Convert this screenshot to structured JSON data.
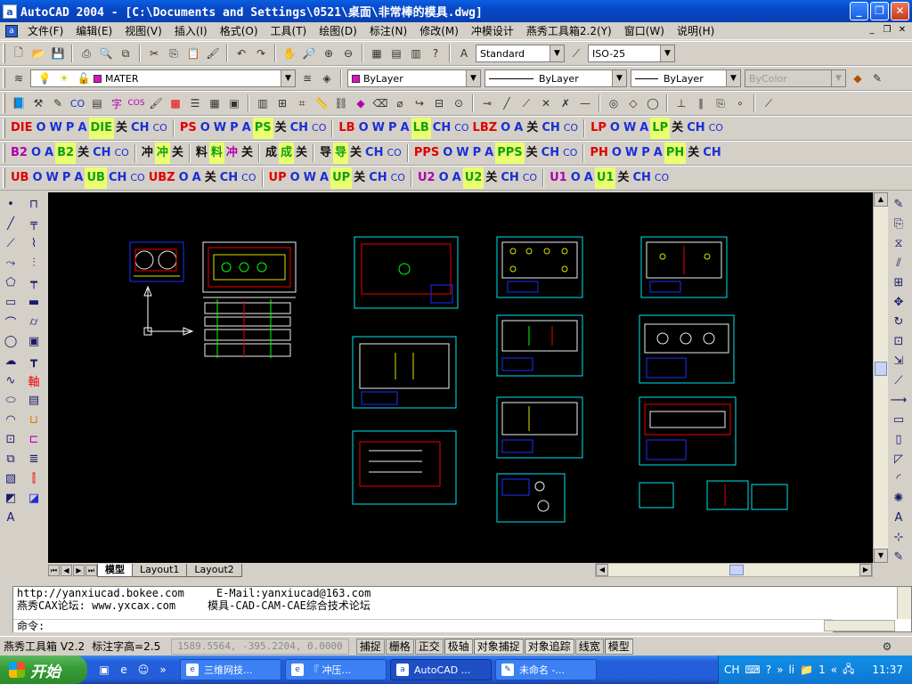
{
  "window": {
    "app_icon": "autocad-icon",
    "title": "AutoCAD 2004 - [C:\\Documents and Settings\\0521\\桌面\\非常棒的模具.dwg]"
  },
  "menu": {
    "items": [
      "文件(F)",
      "编辑(E)",
      "视图(V)",
      "插入(I)",
      "格式(O)",
      "工具(T)",
      "绘图(D)",
      "标注(N)",
      "修改(M)",
      "冲模设计",
      "燕秀工具箱2.2(Y)",
      "窗口(W)",
      "说明(H)"
    ]
  },
  "toolbar": {
    "text_style": "Standard",
    "dim_style": "ISO-25",
    "layer": "MATER",
    "color": "ByLayer",
    "linetype": "ByLayer",
    "lineweight": "ByLayer",
    "plotstyle": "ByColor"
  },
  "custom_rows": [
    [
      [
        "DIE",
        "cr"
      ],
      [
        "O",
        "cb"
      ],
      [
        "W",
        "cb"
      ],
      [
        "P",
        "cb"
      ],
      [
        "A",
        "cb"
      ],
      [
        "DIE",
        "cg"
      ],
      [
        "关",
        "ck"
      ],
      [
        "CH",
        "cb"
      ],
      [
        "CO",
        "small"
      ],
      [
        "|",
        ""
      ],
      [
        "PS",
        "cr"
      ],
      [
        "O",
        "cb"
      ],
      [
        "W",
        "cb"
      ],
      [
        "P",
        "cb"
      ],
      [
        "A",
        "cb"
      ],
      [
        "PS",
        "cg"
      ],
      [
        "关",
        "ck"
      ],
      [
        "CH",
        "cb"
      ],
      [
        "CO",
        "small"
      ],
      [
        "|",
        ""
      ],
      [
        "LB",
        "cr"
      ],
      [
        "O",
        "cb"
      ],
      [
        "W",
        "cb"
      ],
      [
        "P",
        "cb"
      ],
      [
        "A",
        "cb"
      ],
      [
        "LB",
        "cg"
      ],
      [
        "CH",
        "cb"
      ],
      [
        "CO",
        "small"
      ],
      [
        "LBZ",
        "cr"
      ],
      [
        "O",
        "cb"
      ],
      [
        "A",
        "cb"
      ],
      [
        "关",
        "ck"
      ],
      [
        "CH",
        "cb"
      ],
      [
        "CO",
        "small"
      ],
      [
        "|",
        ""
      ],
      [
        "LP",
        "cr"
      ],
      [
        "O",
        "cb"
      ],
      [
        "W",
        "cb"
      ],
      [
        "A",
        "cb"
      ],
      [
        "LP",
        "cg"
      ],
      [
        "关",
        "ck"
      ],
      [
        "CH",
        "cb"
      ],
      [
        "CO",
        "small"
      ]
    ],
    [
      [
        "B2",
        "cm"
      ],
      [
        "O",
        "cb"
      ],
      [
        "A",
        "cb"
      ],
      [
        "B2",
        "cg"
      ],
      [
        "关",
        "ck"
      ],
      [
        "CH",
        "cb"
      ],
      [
        "CO",
        "small"
      ],
      [
        "|",
        ""
      ],
      [
        "冲",
        "ck"
      ],
      [
        "冲",
        "cg"
      ],
      [
        "关",
        "ck"
      ],
      [
        "|",
        ""
      ],
      [
        "料",
        "ck"
      ],
      [
        "料",
        "cg"
      ],
      [
        "冲",
        "cm"
      ],
      [
        "关",
        "ck"
      ],
      [
        "|",
        ""
      ],
      [
        "成",
        "ck"
      ],
      [
        "成",
        "cg"
      ],
      [
        "关",
        "ck"
      ],
      [
        "|",
        ""
      ],
      [
        "导",
        "ck"
      ],
      [
        "导",
        "cg"
      ],
      [
        "关",
        "ck"
      ],
      [
        "CH",
        "cb"
      ],
      [
        "CO",
        "small"
      ],
      [
        "|",
        ""
      ],
      [
        "PPS",
        "cr"
      ],
      [
        "O",
        "cb"
      ],
      [
        "W",
        "cb"
      ],
      [
        "P",
        "cb"
      ],
      [
        "A",
        "cb"
      ],
      [
        "PPS",
        "cg"
      ],
      [
        "关",
        "ck"
      ],
      [
        "CH",
        "cb"
      ],
      [
        "CO",
        "small"
      ],
      [
        "|",
        ""
      ],
      [
        "PH",
        "cr"
      ],
      [
        "O",
        "cb"
      ],
      [
        "W",
        "cb"
      ],
      [
        "P",
        "cb"
      ],
      [
        "A",
        "cb"
      ],
      [
        "PH",
        "cg"
      ],
      [
        "关",
        "ck"
      ],
      [
        "CH",
        "cb"
      ]
    ],
    [
      [
        "UB",
        "cr"
      ],
      [
        "O",
        "cb"
      ],
      [
        "W",
        "cb"
      ],
      [
        "P",
        "cb"
      ],
      [
        "A",
        "cb"
      ],
      [
        "UB",
        "cg"
      ],
      [
        "CH",
        "cb"
      ],
      [
        "CO",
        "small"
      ],
      [
        "UBZ",
        "cr"
      ],
      [
        "O",
        "cb"
      ],
      [
        "A",
        "cb"
      ],
      [
        "关",
        "ck"
      ],
      [
        "CH",
        "cb"
      ],
      [
        "CO",
        "small"
      ],
      [
        "|",
        ""
      ],
      [
        "UP",
        "cr"
      ],
      [
        "O",
        "cb"
      ],
      [
        "W",
        "cb"
      ],
      [
        "A",
        "cb"
      ],
      [
        "UP",
        "cg"
      ],
      [
        "关",
        "ck"
      ],
      [
        "CH",
        "cb"
      ],
      [
        "CO",
        "small"
      ],
      [
        "|",
        ""
      ],
      [
        "U2",
        "cm"
      ],
      [
        "O",
        "cb"
      ],
      [
        "A",
        "cb"
      ],
      [
        "U2",
        "cg"
      ],
      [
        "关",
        "ck"
      ],
      [
        "CH",
        "cb"
      ],
      [
        "CO",
        "small"
      ],
      [
        "|",
        ""
      ],
      [
        "U1",
        "cm"
      ],
      [
        "O",
        "cb"
      ],
      [
        "A",
        "cb"
      ],
      [
        "U1",
        "cg"
      ],
      [
        "关",
        "ck"
      ],
      [
        "CH",
        "cb"
      ],
      [
        "CO",
        "small"
      ]
    ]
  ],
  "tabs": {
    "model": "模型",
    "layout1": "Layout1",
    "layout2": "Layout2"
  },
  "command": {
    "line1": "http://yanxiucad.bokee.com     E-Mail:yanxiucad@163.com",
    "line2": "燕秀CAX论坛: www.yxcax.com     模具-CAD-CAM-CAE综合技术论坛",
    "prompt": "命令:"
  },
  "status": {
    "toolbox": "燕秀工具箱 V2.2",
    "text_height": "标注字高=2.5",
    "coords": "1589.5564, -395.2204, 0.0000",
    "toggles": [
      {
        "label": "捕捉",
        "on": false
      },
      {
        "label": "栅格",
        "on": false
      },
      {
        "label": "正交",
        "on": false
      },
      {
        "label": "极轴",
        "on": true
      },
      {
        "label": "对象捕捉",
        "on": true
      },
      {
        "label": "对象追踪",
        "on": true
      },
      {
        "label": "线宽",
        "on": false
      },
      {
        "label": "模型",
        "on": true
      }
    ]
  },
  "taskbar": {
    "start": "开始",
    "tasks": [
      "三维网技...",
      "『 冲压...",
      "AutoCAD ...",
      "未命名 -..."
    ],
    "active_task": 2,
    "tray": {
      "ime": "CH",
      "clock": "11:37",
      "folder_item": "1",
      "li": "li"
    }
  }
}
